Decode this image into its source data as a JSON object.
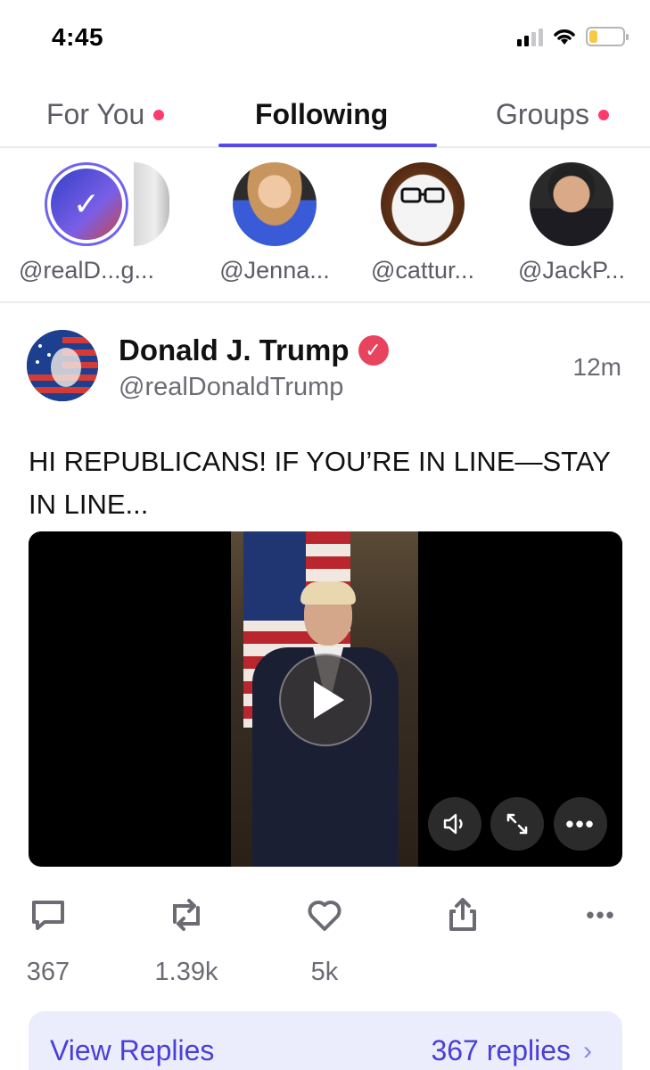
{
  "status_bar": {
    "time": "4:45",
    "battery_level": 0.25,
    "battery_color": "#f7c948"
  },
  "tabs": [
    {
      "label": "For You",
      "has_dot": true
    },
    {
      "label": "Following",
      "active": true
    },
    {
      "label": "Groups",
      "has_dot": true
    }
  ],
  "stories": [
    {
      "handle": "@realD...g...",
      "icon": "check-icon",
      "selected": true
    },
    {
      "handle": "@Jenna..."
    },
    {
      "handle": "@cattur..."
    },
    {
      "handle": "@JackP..."
    }
  ],
  "post": {
    "author_name": "Donald J. Trump",
    "handle": "@realDonaldTrump",
    "time": "12m",
    "text": "HI REPUBLICANS! IF YOU’RE IN LINE—STAY IN LINE...",
    "video_controls": [
      "volume-icon",
      "fullscreen-icon",
      "more-icon"
    ],
    "actions": {
      "replies": "367",
      "reposts": "1.39k",
      "likes": "5k"
    }
  },
  "replies_bar": {
    "label": "View Replies",
    "count_text": "367 replies"
  },
  "colors": {
    "accent": "#5448ee",
    "dot": "#ff3b6b",
    "verified": "#e8445d",
    "replies_bg": "#ebedfd"
  }
}
